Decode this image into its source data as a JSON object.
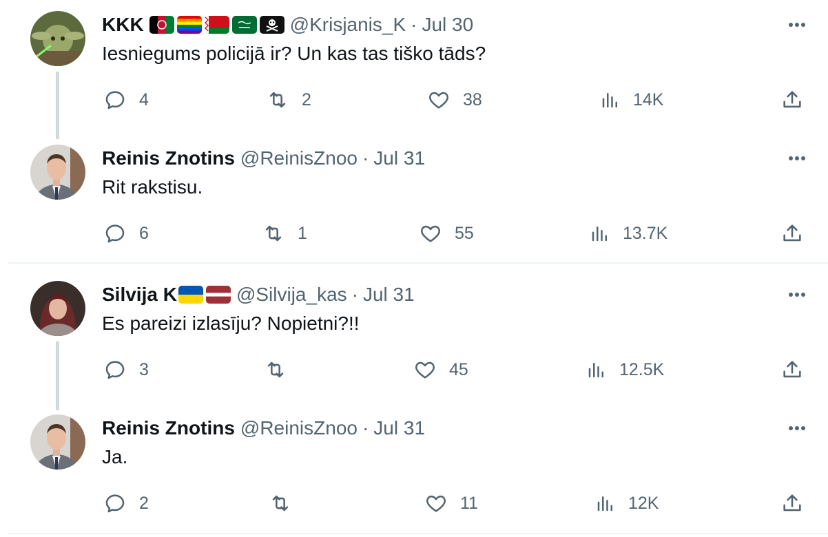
{
  "tweets": [
    {
      "name": "KKK",
      "flags": [
        "afghanistan-flag",
        "rainbow-flag",
        "belarus-flag",
        "saudi-flag",
        "pirate-flag"
      ],
      "handle": "@Krisjanis_K",
      "separator": "·",
      "date": "Jul 30",
      "text": "Iesniegums policijā ir? Un kas tas tiško tāds?",
      "replies": "4",
      "retweets": "2",
      "likes": "38",
      "views": "14K"
    },
    {
      "name": "Reinis Znotins",
      "handle": "@ReinisZnoo",
      "separator": "·",
      "date": "Jul 31",
      "text": "Rit rakstisu.",
      "replies": "6",
      "retweets": "1",
      "likes": "55",
      "views": "13.7K"
    },
    {
      "name": "Silvija K",
      "flags": [
        "ukraine-flag",
        "latvia-flag"
      ],
      "handle": "@Silvija_kas",
      "separator": "·",
      "date": "Jul 31",
      "text": "Es pareizi izlasīju? Nopietni?!!",
      "replies": "3",
      "retweets": "",
      "likes": "45",
      "views": "12.5K"
    },
    {
      "name": "Reinis Znotins",
      "handle": "@ReinisZnoo",
      "separator": "·",
      "date": "Jul 31",
      "text": "Ja.",
      "replies": "2",
      "retweets": "",
      "likes": "11",
      "views": "12K"
    }
  ],
  "icons": {
    "reply": "reply-icon",
    "retweet": "retweet-icon",
    "like": "like-icon",
    "views": "views-icon",
    "share": "share-icon",
    "more": "more-icon"
  },
  "colors": {
    "text": "#0f1419",
    "secondary": "#536471",
    "thread_line": "#cfd9de",
    "divider": "#eff3f4"
  }
}
